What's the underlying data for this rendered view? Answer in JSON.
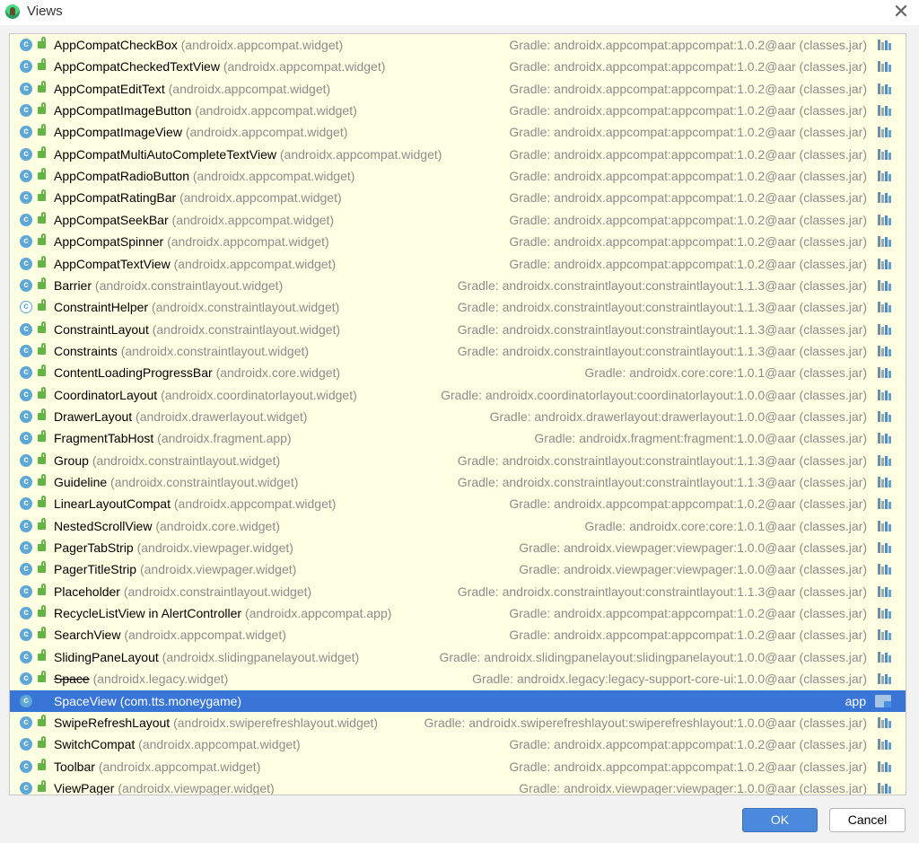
{
  "window": {
    "title": "Views",
    "close_glyph": "✕"
  },
  "rows": [
    {
      "cls": "AppCompatCheckBox",
      "pkg": "(androidx.appcompat.widget)",
      "lib": "Gradle: androidx.appcompat:appcompat:1.0.2@aar (classes.jar)"
    },
    {
      "cls": "AppCompatCheckedTextView",
      "pkg": "(androidx.appcompat.widget)",
      "lib": "Gradle: androidx.appcompat:appcompat:1.0.2@aar (classes.jar)"
    },
    {
      "cls": "AppCompatEditText",
      "pkg": "(androidx.appcompat.widget)",
      "lib": "Gradle: androidx.appcompat:appcompat:1.0.2@aar (classes.jar)"
    },
    {
      "cls": "AppCompatImageButton",
      "pkg": "(androidx.appcompat.widget)",
      "lib": "Gradle: androidx.appcompat:appcompat:1.0.2@aar (classes.jar)"
    },
    {
      "cls": "AppCompatImageView",
      "pkg": "(androidx.appcompat.widget)",
      "lib": "Gradle: androidx.appcompat:appcompat:1.0.2@aar (classes.jar)"
    },
    {
      "cls": "AppCompatMultiAutoCompleteTextView",
      "pkg": "(androidx.appcompat.widget)",
      "lib": "Gradle: androidx.appcompat:appcompat:1.0.2@aar (classes.jar)"
    },
    {
      "cls": "AppCompatRadioButton",
      "pkg": "(androidx.appcompat.widget)",
      "lib": "Gradle: androidx.appcompat:appcompat:1.0.2@aar (classes.jar)"
    },
    {
      "cls": "AppCompatRatingBar",
      "pkg": "(androidx.appcompat.widget)",
      "lib": "Gradle: androidx.appcompat:appcompat:1.0.2@aar (classes.jar)"
    },
    {
      "cls": "AppCompatSeekBar",
      "pkg": "(androidx.appcompat.widget)",
      "lib": "Gradle: androidx.appcompat:appcompat:1.0.2@aar (classes.jar)"
    },
    {
      "cls": "AppCompatSpinner",
      "pkg": "(androidx.appcompat.widget)",
      "lib": "Gradle: androidx.appcompat:appcompat:1.0.2@aar (classes.jar)"
    },
    {
      "cls": "AppCompatTextView",
      "pkg": "(androidx.appcompat.widget)",
      "lib": "Gradle: androidx.appcompat:appcompat:1.0.2@aar (classes.jar)"
    },
    {
      "cls": "Barrier",
      "pkg": "(androidx.constraintlayout.widget)",
      "lib": "Gradle: androidx.constraintlayout:constraintlayout:1.1.3@aar (classes.jar)"
    },
    {
      "cls": "ConstraintHelper",
      "pkg": "(androidx.constraintlayout.widget)",
      "lib": "Gradle: androidx.constraintlayout:constraintlayout:1.1.3@aar (classes.jar)",
      "abstract": true
    },
    {
      "cls": "ConstraintLayout",
      "pkg": "(androidx.constraintlayout.widget)",
      "lib": "Gradle: androidx.constraintlayout:constraintlayout:1.1.3@aar (classes.jar)"
    },
    {
      "cls": "Constraints",
      "pkg": "(androidx.constraintlayout.widget)",
      "lib": "Gradle: androidx.constraintlayout:constraintlayout:1.1.3@aar (classes.jar)"
    },
    {
      "cls": "ContentLoadingProgressBar",
      "pkg": "(androidx.core.widget)",
      "lib": "Gradle: androidx.core:core:1.0.1@aar (classes.jar)"
    },
    {
      "cls": "CoordinatorLayout",
      "pkg": "(androidx.coordinatorlayout.widget)",
      "lib": "Gradle: androidx.coordinatorlayout:coordinatorlayout:1.0.0@aar (classes.jar)"
    },
    {
      "cls": "DrawerLayout",
      "pkg": "(androidx.drawerlayout.widget)",
      "lib": "Gradle: androidx.drawerlayout:drawerlayout:1.0.0@aar (classes.jar)"
    },
    {
      "cls": "FragmentTabHost",
      "pkg": "(androidx.fragment.app)",
      "lib": "Gradle: androidx.fragment:fragment:1.0.0@aar (classes.jar)"
    },
    {
      "cls": "Group",
      "pkg": "(androidx.constraintlayout.widget)",
      "lib": "Gradle: androidx.constraintlayout:constraintlayout:1.1.3@aar (classes.jar)"
    },
    {
      "cls": "Guideline",
      "pkg": "(androidx.constraintlayout.widget)",
      "lib": "Gradle: androidx.constraintlayout:constraintlayout:1.1.3@aar (classes.jar)"
    },
    {
      "cls": "LinearLayoutCompat",
      "pkg": "(androidx.appcompat.widget)",
      "lib": "Gradle: androidx.appcompat:appcompat:1.0.2@aar (classes.jar)"
    },
    {
      "cls": "NestedScrollView",
      "pkg": "(androidx.core.widget)",
      "lib": "Gradle: androidx.core:core:1.0.1@aar (classes.jar)"
    },
    {
      "cls": "PagerTabStrip",
      "pkg": "(androidx.viewpager.widget)",
      "lib": "Gradle: androidx.viewpager:viewpager:1.0.0@aar (classes.jar)"
    },
    {
      "cls": "PagerTitleStrip",
      "pkg": "(androidx.viewpager.widget)",
      "lib": "Gradle: androidx.viewpager:viewpager:1.0.0@aar (classes.jar)"
    },
    {
      "cls": "Placeholder",
      "pkg": "(androidx.constraintlayout.widget)",
      "lib": "Gradle: androidx.constraintlayout:constraintlayout:1.1.3@aar (classes.jar)"
    },
    {
      "cls": "RecycleListView in AlertController",
      "pkg": "(androidx.appcompat.app)",
      "lib": "Gradle: androidx.appcompat:appcompat:1.0.2@aar (classes.jar)"
    },
    {
      "cls": "SearchView",
      "pkg": "(androidx.appcompat.widget)",
      "lib": "Gradle: androidx.appcompat:appcompat:1.0.2@aar (classes.jar)"
    },
    {
      "cls": "SlidingPaneLayout",
      "pkg": "(androidx.slidingpanelayout.widget)",
      "lib": "Gradle: androidx.slidingpanelayout:slidingpanelayout:1.0.0@aar (classes.jar)"
    },
    {
      "cls": "Space",
      "pkg": "(androidx.legacy.widget)",
      "lib": "Gradle: androidx.legacy:legacy-support-core-ui:1.0.0@aar (classes.jar)",
      "deprecated": true
    },
    {
      "cls": "SpaceView",
      "pkg": "(com.tts.moneygame)",
      "lib": "app",
      "selected": true
    },
    {
      "cls": "SwipeRefreshLayout",
      "pkg": "(androidx.swiperefreshlayout.widget)",
      "lib": "Gradle: androidx.swiperefreshlayout:swiperefreshlayout:1.0.0@aar (classes.jar)"
    },
    {
      "cls": "SwitchCompat",
      "pkg": "(androidx.appcompat.widget)",
      "lib": "Gradle: androidx.appcompat:appcompat:1.0.2@aar (classes.jar)"
    },
    {
      "cls": "Toolbar",
      "pkg": "(androidx.appcompat.widget)",
      "lib": "Gradle: androidx.appcompat:appcompat:1.0.2@aar (classes.jar)"
    },
    {
      "cls": "ViewPager",
      "pkg": "(androidx.viewpager.widget)",
      "lib": "Gradle: androidx.viewpager:viewpager:1.0.0@aar (classes.jar)"
    }
  ],
  "icons": {
    "class_glyph": "c"
  },
  "buttons": {
    "ok": "OK",
    "cancel": "Cancel"
  },
  "colors": {
    "selection": "#3875d7",
    "list_bg": "#ffffe4",
    "ok_bg": "#4a89dc"
  }
}
